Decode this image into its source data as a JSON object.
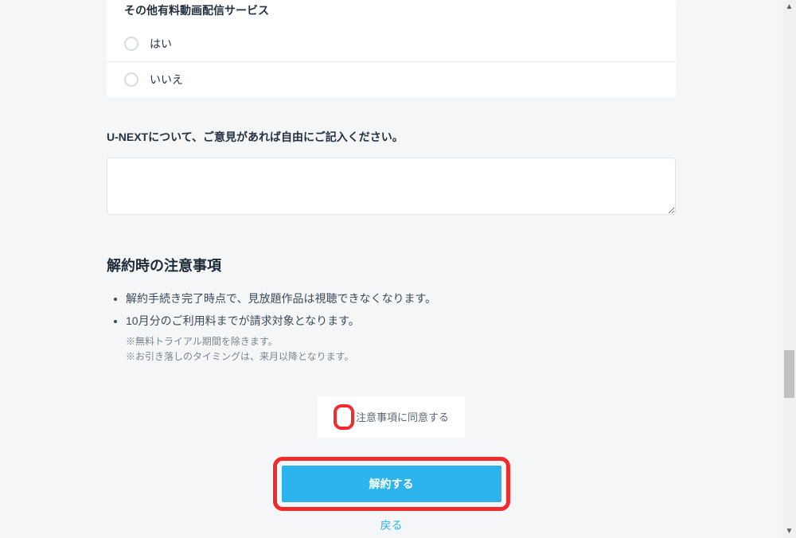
{
  "survey": {
    "otherServiceQuestion": "その他有料動画配信サービス",
    "options": {
      "yes": "はい",
      "no": "いいえ"
    },
    "freeTextPrompt": "U-NEXTについて、ご意見があれば自由にご記入ください。"
  },
  "cancelNotes": {
    "heading": "解約時の注意事項",
    "items": [
      "解約手続き完了時点で、見放題作品は視聴できなくなります。",
      "10月分のご利用料までが請求対象となります。"
    ],
    "subnotes": [
      "※無料トライアル期間を除きます。",
      "※お引き落しのタイミングは、来月以降となります。"
    ]
  },
  "consent": {
    "label": "注意事項に同意する"
  },
  "actions": {
    "cancelLabel": "解約する",
    "backLabel": "戻る"
  }
}
